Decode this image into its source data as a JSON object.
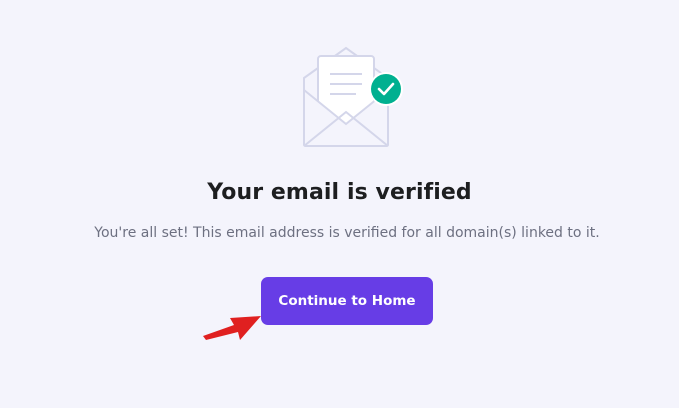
{
  "illustration": {
    "icon": "envelope-verified-icon",
    "check_color": "#00b090"
  },
  "main": {
    "title": "Your email is verified",
    "subtitle": "You're all set! This email address is verified for all domain(s) linked to it.",
    "cta_label": "Continue to Home"
  },
  "colors": {
    "background": "#f4f4fc",
    "accent": "#673de6",
    "annotation_arrow": "#e02020"
  }
}
